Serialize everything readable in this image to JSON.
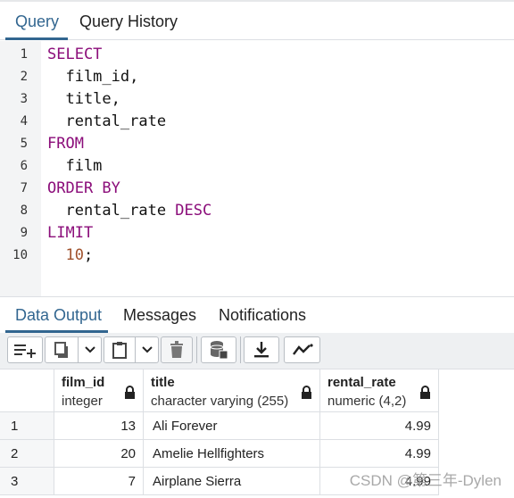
{
  "query_tabs": [
    {
      "label": "Query",
      "active": true
    },
    {
      "label": "Query History",
      "active": false
    }
  ],
  "editor": {
    "lines": [
      {
        "num": "1",
        "code": [
          {
            "t": "SELECT",
            "c": "kw"
          }
        ]
      },
      {
        "num": "2",
        "code": [
          {
            "t": "  film_id,",
            "c": ""
          }
        ]
      },
      {
        "num": "3",
        "code": [
          {
            "t": "  title,",
            "c": ""
          }
        ]
      },
      {
        "num": "4",
        "code": [
          {
            "t": "  rental_rate",
            "c": ""
          }
        ]
      },
      {
        "num": "5",
        "code": [
          {
            "t": "FROM",
            "c": "kw"
          }
        ]
      },
      {
        "num": "6",
        "code": [
          {
            "t": "  film",
            "c": ""
          }
        ]
      },
      {
        "num": "7",
        "code": [
          {
            "t": "ORDER BY",
            "c": "kw"
          }
        ]
      },
      {
        "num": "8",
        "code": [
          {
            "t": "  rental_rate ",
            "c": ""
          },
          {
            "t": "DESC",
            "c": "kw"
          }
        ]
      },
      {
        "num": "9",
        "code": [
          {
            "t": "LIMIT",
            "c": "kw"
          }
        ]
      },
      {
        "num": "10",
        "code": [
          {
            "t": "  ",
            "c": ""
          },
          {
            "t": "10",
            "c": "num"
          },
          {
            "t": ";",
            "c": ""
          }
        ]
      }
    ]
  },
  "output_tabs": [
    {
      "label": "Data Output",
      "active": true
    },
    {
      "label": "Messages",
      "active": false
    },
    {
      "label": "Notifications",
      "active": false
    }
  ],
  "toolbar_icons": [
    "add-row-icon",
    "copy-icon",
    "chevron-down-icon",
    "paste-icon",
    "chevron-down-icon",
    "delete-icon",
    "save-data-icon",
    "download-icon",
    "graph-icon"
  ],
  "grid": {
    "columns": [
      {
        "name": "film_id",
        "type": "integer"
      },
      {
        "name": "title",
        "type": "character varying (255)"
      },
      {
        "name": "rental_rate",
        "type": "numeric (4,2)"
      }
    ],
    "rows": [
      {
        "n": "1",
        "film_id": "13",
        "title": "Ali Forever",
        "rental_rate": "4.99"
      },
      {
        "n": "2",
        "film_id": "20",
        "title": "Amelie Hellfighters",
        "rental_rate": "4.99"
      },
      {
        "n": "3",
        "film_id": "7",
        "title": "Airplane Sierra",
        "rental_rate": "4.99"
      }
    ]
  },
  "watermark": "CSDN @第三年-Dylen",
  "colors": {
    "accent": "#326690",
    "keyword": "#8b0d7a",
    "number": "#a0522d"
  }
}
